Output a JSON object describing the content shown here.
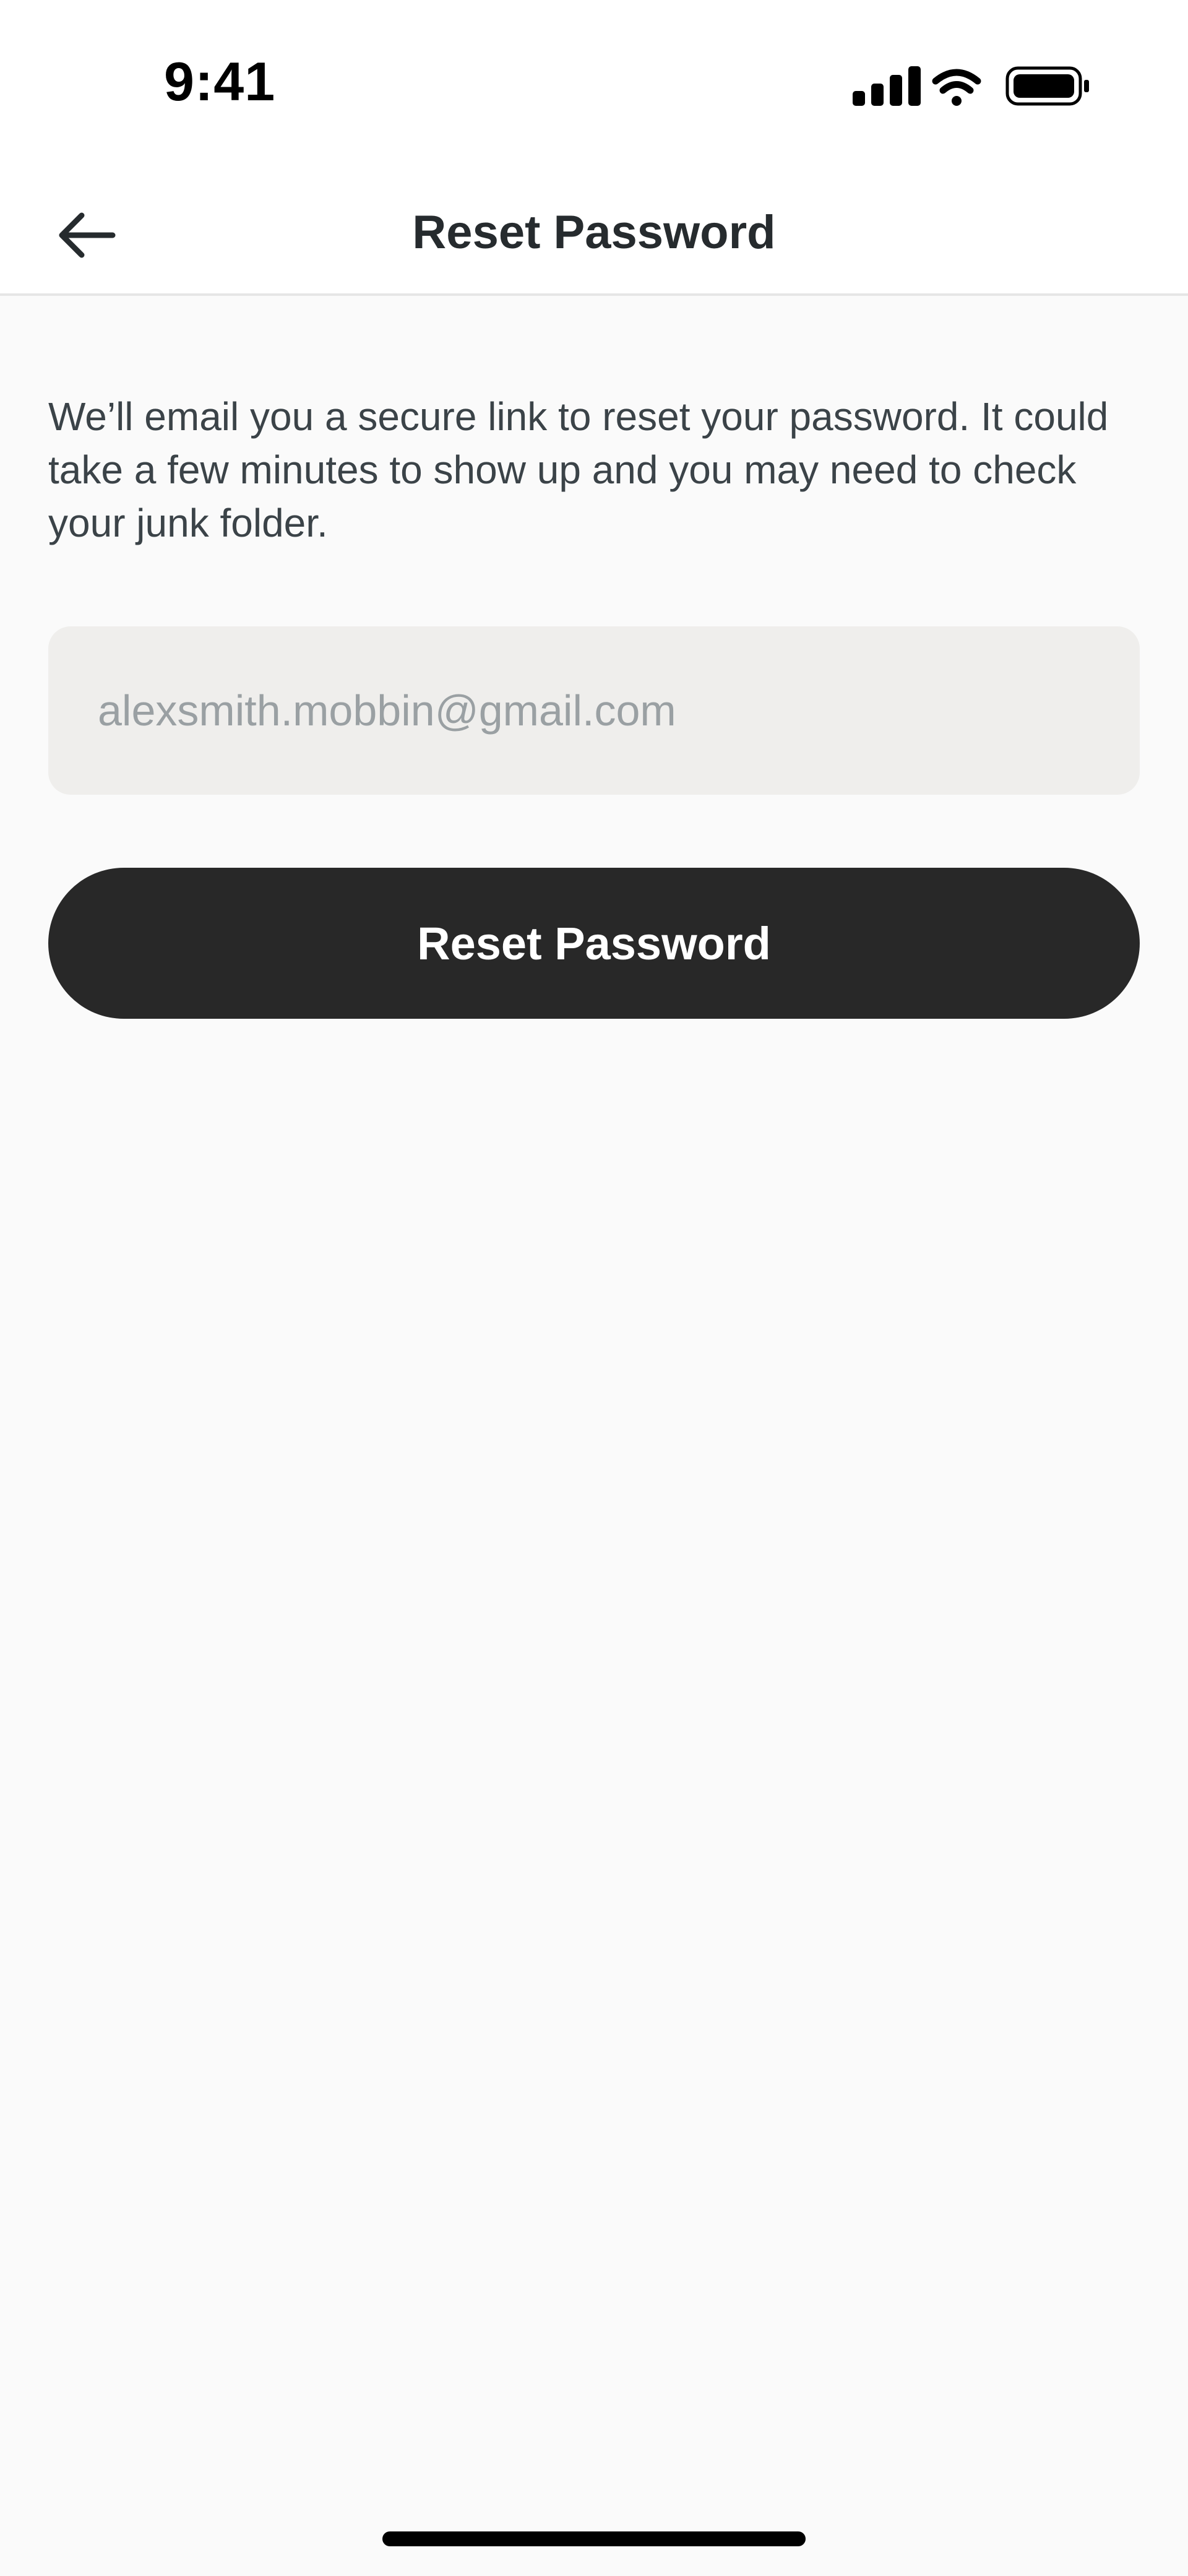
{
  "status_bar": {
    "time": "9:41",
    "icons": [
      "signal-icon",
      "wifi-icon",
      "battery-icon"
    ]
  },
  "nav": {
    "title": "Reset Password",
    "back_icon": "arrow-left-icon"
  },
  "content": {
    "description": "We’ll email you a secure link to reset your password. It could take a few minutes to show up and you may need to check your junk folder.",
    "email_placeholder": "alexsmith.mobbin@gmail.com",
    "reset_button_label": "Reset Password"
  },
  "colors": {
    "background": "#fafafa",
    "header_background": "#ffffff",
    "text_primary": "#262b2e",
    "text_secondary": "#3b4348",
    "input_background": "#efeeec",
    "placeholder": "#9aa0a3",
    "button_background": "#282828",
    "button_text": "#ffffff"
  }
}
